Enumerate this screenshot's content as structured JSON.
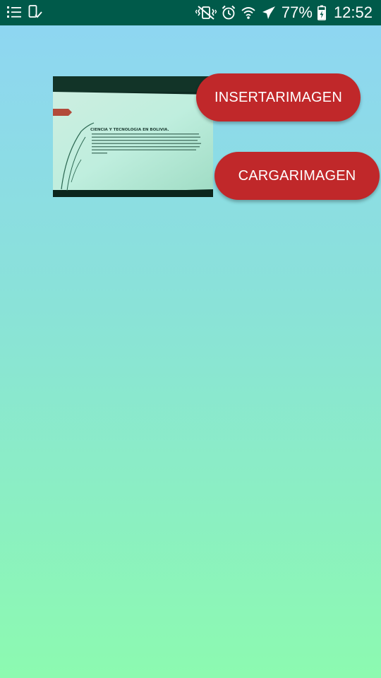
{
  "status_bar": {
    "battery_percent": "77%",
    "time": "12:52",
    "icons": [
      "notification-list-icon",
      "device-check-icon",
      "vibrate-mute-icon",
      "alarm-icon",
      "wifi-icon",
      "airplane-mode-icon",
      "battery-charging-icon"
    ],
    "background_color": "#005a4a"
  },
  "photo": {
    "slide_title": "CIENCIA Y TECNOLOGIA EN BOLIVIA."
  },
  "buttons": {
    "insert_label": "INSERTARIMAGEN",
    "load_label": "CARGARIMAGEN",
    "color": "#c0282a"
  },
  "background": {
    "gradient_top": "#8fd5f4",
    "gradient_bottom": "#8cfab0"
  }
}
